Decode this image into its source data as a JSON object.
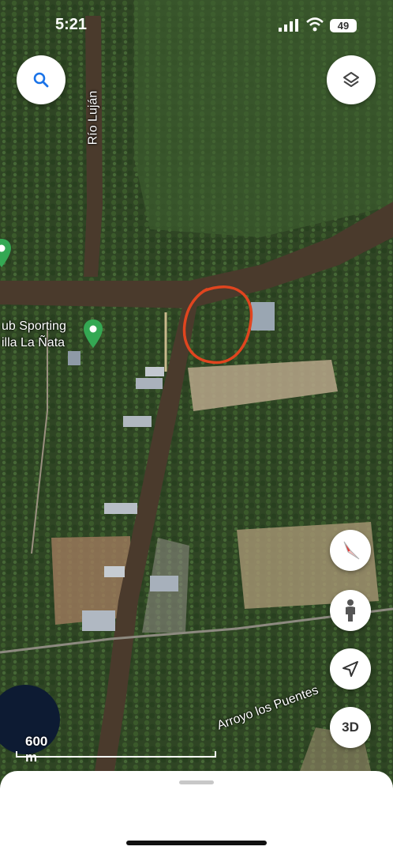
{
  "status_bar": {
    "time": "5:21",
    "battery": "49",
    "signal_icon": "cellular-signal-icon",
    "wifi_icon": "wifi-icon"
  },
  "map": {
    "type": "satellite",
    "labels": {
      "river_lujan": "Río Luján",
      "club": "ub Sporting",
      "villa": "illa La Ñata",
      "arroyo": "Arroyo los Puentes"
    },
    "annotation": "red hand-drawn circle",
    "scale": "600 m",
    "colors": {
      "water": "#4a3a2c",
      "annotation": "#e0451f",
      "pin": "#34a853"
    }
  },
  "controls": {
    "search_icon": "search-icon",
    "layers_icon": "layers-icon",
    "compass_icon": "compass-icon",
    "street_view_icon": "pegman-icon",
    "location_icon": "navigation-arrow-icon",
    "three_d": "3D"
  }
}
